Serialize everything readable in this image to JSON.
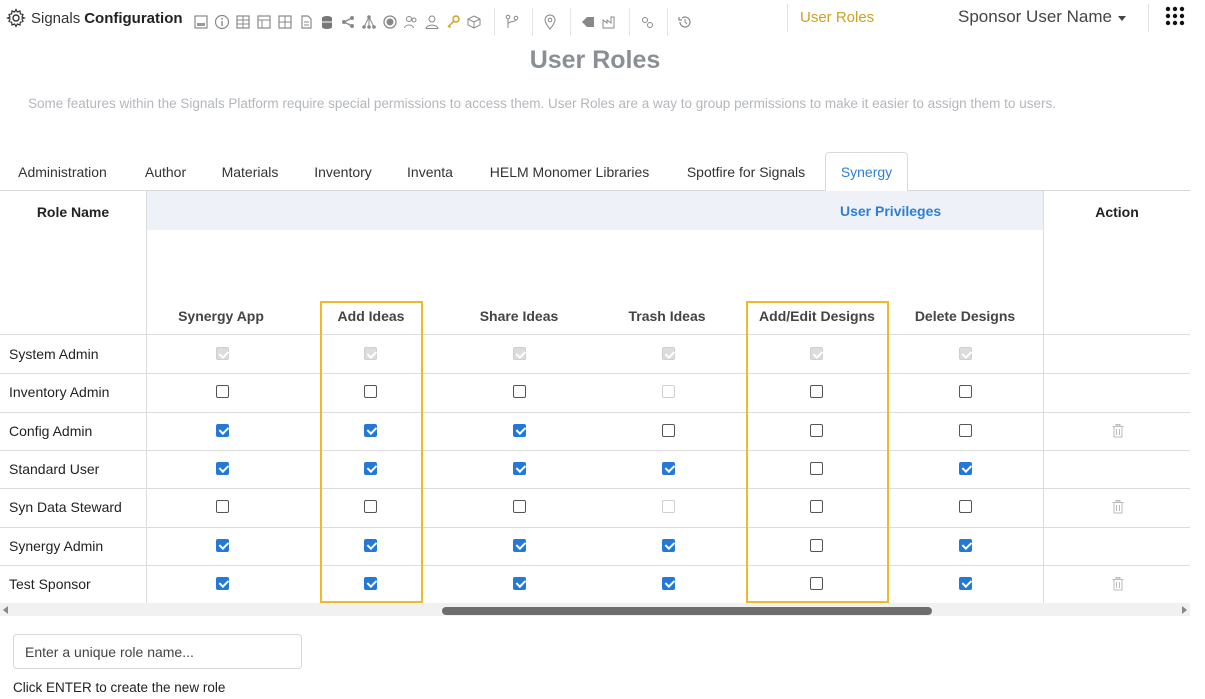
{
  "header": {
    "brand_light": "Signals",
    "brand_bold": "Configuration",
    "tool_icons": [
      "layout-icon",
      "info-icon",
      "table-icon",
      "list-table-icon",
      "grid-icon",
      "document-icon",
      "database-icon",
      "share-icon",
      "tree-icon",
      "target-icon",
      "users-icon",
      "user-icon",
      "key-icon",
      "cube-icon",
      "branch-icon",
      "location-icon",
      "tag-icon",
      "factory-icon",
      "settings-icon",
      "history-icon"
    ],
    "active_link": "User Roles",
    "user_name": "Sponsor User Name",
    "accent_color": "#c9a227"
  },
  "page": {
    "title": "User Roles",
    "description": "Some features within the Signals Platform require special permissions to access them. User Roles are a way to group permissions to make it easier to assign them to users."
  },
  "tabs": [
    "Administration",
    "Author",
    "Materials",
    "Inventory",
    "Inventa",
    "HELM Monomer Libraries",
    "Spotfire for Signals",
    "Synergy"
  ],
  "active_tab": "Synergy",
  "table": {
    "role_header": "Role Name",
    "privileges_header": "User Privileges",
    "action_header": "Action",
    "columns": [
      "Synergy App",
      "Add Ideas",
      "Share Ideas",
      "Trash Ideas",
      "Add/Edit Designs",
      "Delete Designs"
    ],
    "highlighted_columns": [
      "Add Ideas",
      "Add/Edit Designs"
    ],
    "rows": [
      {
        "name": "System Admin",
        "values": [
          "locked-checked",
          "locked-checked",
          "locked-checked",
          "locked-checked",
          "locked-checked",
          "locked-checked"
        ],
        "deletable": false
      },
      {
        "name": "Inventory Admin",
        "values": [
          "unchecked",
          "unchecked",
          "unchecked",
          "disabled",
          "unchecked",
          "unchecked"
        ],
        "deletable": false
      },
      {
        "name": "Config Admin",
        "values": [
          "checked",
          "checked",
          "checked",
          "unchecked",
          "unchecked",
          "unchecked"
        ],
        "deletable": true
      },
      {
        "name": "Standard User",
        "values": [
          "checked",
          "checked",
          "checked",
          "checked",
          "unchecked",
          "checked"
        ],
        "deletable": false
      },
      {
        "name": "Syn Data Steward",
        "values": [
          "unchecked",
          "unchecked",
          "unchecked",
          "disabled",
          "unchecked",
          "unchecked"
        ],
        "deletable": true
      },
      {
        "name": "Synergy Admin",
        "values": [
          "checked",
          "checked",
          "checked",
          "checked",
          "unchecked",
          "checked"
        ],
        "deletable": false
      },
      {
        "name": "Test Sponsor",
        "values": [
          "checked",
          "checked",
          "checked",
          "checked",
          "unchecked",
          "checked"
        ],
        "deletable": true
      }
    ]
  },
  "new_role": {
    "placeholder": "Enter a unique role name...",
    "hint": "Click ENTER to create the new role"
  },
  "colors": {
    "checkbox_blue": "#2478d6",
    "highlight": "#f0b92a",
    "link_blue": "#2f7fd1"
  }
}
